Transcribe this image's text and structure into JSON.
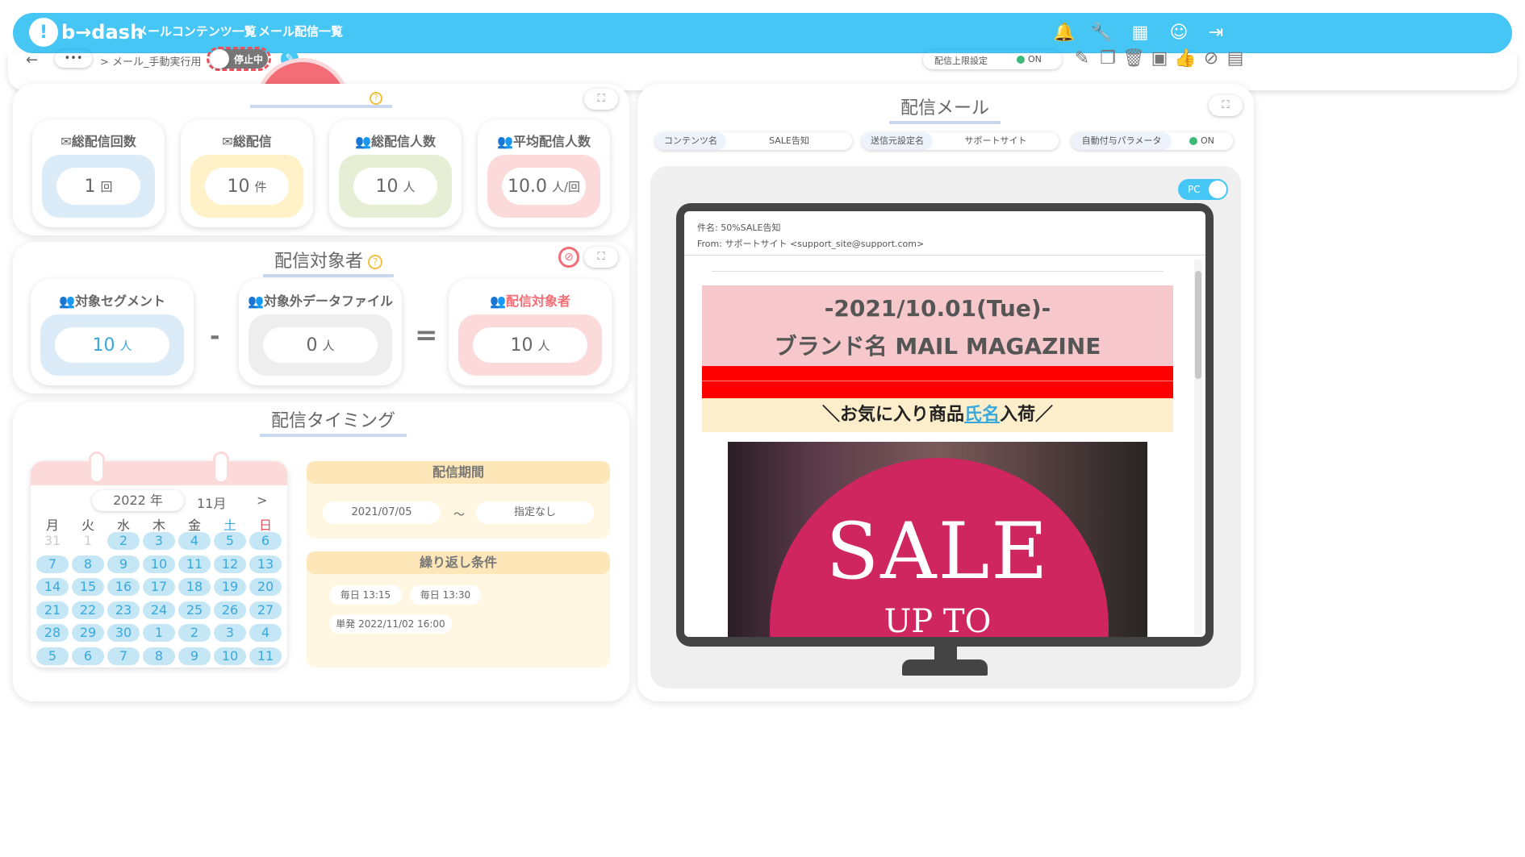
{
  "header": {
    "logo": "b→dash",
    "nav": [
      "メールコンテンツ一覧",
      "メール配信一覧"
    ],
    "icons": [
      "bell-icon",
      "wrench-icon",
      "grid-icon",
      "support-icon",
      "logout-icon"
    ]
  },
  "subbar": {
    "back": "←",
    "more": "•••",
    "breadcrumb": "> メール_手動実行用",
    "status_toggle": "停止中",
    "limit_label": "配信上限設定",
    "limit_state": "ON"
  },
  "summary": {
    "cards": [
      {
        "label": "総配信回数",
        "value": "1",
        "unit": "回",
        "color": "#dcebf8"
      },
      {
        "label": "総配信",
        "value": "10",
        "unit": "件",
        "color": "#fff2c8"
      },
      {
        "label": "総配信人数",
        "value": "10",
        "unit": "人",
        "color": "#e6efd6"
      },
      {
        "label": "平均配信人数",
        "value": "10.0",
        "unit": "人/回",
        "color": "#fcdada"
      }
    ]
  },
  "audience": {
    "title": "配信対象者",
    "cards": [
      {
        "label": "対象セグメント",
        "value": "10",
        "unit": "人"
      },
      {
        "label": "対象外データファイル",
        "value": "0",
        "unit": "人"
      },
      {
        "label": "配信対象者",
        "value": "10",
        "unit": "人"
      }
    ],
    "minus": "-",
    "equals": "="
  },
  "timing": {
    "title": "配信タイミング",
    "calendar": {
      "year": "2022",
      "year_unit": "年",
      "month": "11月",
      "next": ">",
      "weekdays": [
        "月",
        "火",
        "水",
        "木",
        "金",
        "土",
        "日"
      ],
      "days": [
        "31",
        "1",
        "2",
        "3",
        "4",
        "5",
        "6",
        "7",
        "8",
        "9",
        "10",
        "11",
        "12",
        "13",
        "14",
        "15",
        "16",
        "17",
        "18",
        "19",
        "20",
        "21",
        "22",
        "23",
        "24",
        "25",
        "26",
        "27",
        "28",
        "29",
        "30",
        "1",
        "2",
        "3",
        "4",
        "5",
        "6",
        "7",
        "8",
        "9",
        "10",
        "11"
      ]
    },
    "period": {
      "header": "配信期間",
      "start": "2021/07/05",
      "tilde": "～",
      "end": "指定なし"
    },
    "repeat": {
      "header": "繰り返し条件",
      "items": [
        "毎日 13:15",
        "毎日 13:30",
        "単発 2022/11/02 16:00"
      ]
    }
  },
  "mail": {
    "title": "配信メール",
    "tags": [
      {
        "label": "コンテンツ名",
        "value": "SALE告知"
      },
      {
        "label": "送信元設定名",
        "value": "サポートサイト"
      },
      {
        "label": "自動付与パラメータ",
        "value": "ON"
      }
    ],
    "device_toggle": "PC",
    "subject": "件名: 50%SALE告知",
    "from": "From: サポートサイト <support_site@support.com>",
    "banner_line1": "-2021/10.01(Tue)-",
    "banner_line2": "ブランド名 MAIL MAGAZINE",
    "tagline_pre": "＼お気に入り商品",
    "tagline_name": "氏名",
    "tagline_post": "入荷／",
    "sale_text": "SALE",
    "upto_text": "UP TO"
  }
}
